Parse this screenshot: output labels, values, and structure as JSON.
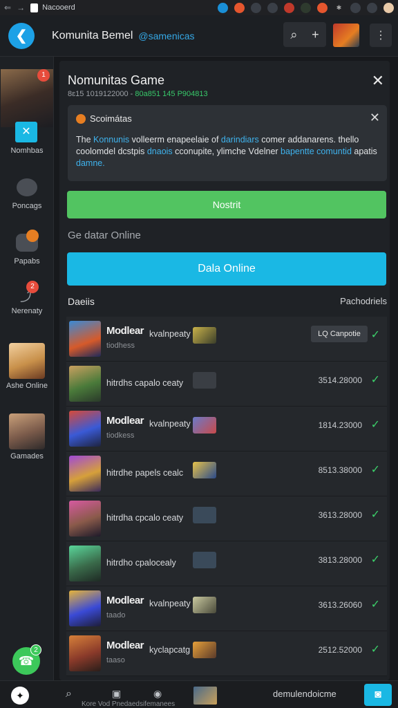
{
  "browser": {
    "tab_title": "Nacooerd",
    "back": "⇐",
    "forward": "→"
  },
  "header": {
    "title": "Komunita Bemel",
    "handle": "@samenicas",
    "search_icon": "⌕",
    "add_icon": "+",
    "menu_icon": "⋮"
  },
  "sidebar": {
    "items": [
      {
        "label": "Nomhbas"
      },
      {
        "label": "Poncags"
      },
      {
        "label": "Papabs"
      },
      {
        "label": "Nerenaty"
      },
      {
        "label": "Ashe Online"
      },
      {
        "label": "Gamades"
      }
    ],
    "badges": [
      "1",
      "2"
    ],
    "fab_badge": "2"
  },
  "panel": {
    "title": "Nomunitas Game",
    "sub_a": "8ɛ15 1019122000 -",
    "sub_b": "80a851 145 P904813",
    "notice_title": "Scoimátas",
    "notice_body_1": "The",
    "notice_body_2": "Konnunis",
    "notice_body_3": "volleerm enapeelaie of",
    "notice_body_4": "darindiars",
    "notice_body_5": "comer addanarens. thello coolomdel dcstpis",
    "notice_body_6": "dnaois",
    "notice_body_7": "cconupite, ylimche Vdelner",
    "notice_body_8": "bapentte comuntid",
    "notice_body_9": "apatis",
    "notice_body_10": "damne.",
    "green_button": "Nostrit",
    "section_label": "Ge datar Online",
    "blue_button": "Dala Online",
    "list_header_left": "Daeiis",
    "list_header_right": "Pachodriels"
  },
  "rows": [
    {
      "title": "Modlear",
      "title2": "kvalnpeaty",
      "sub": "tiodhess",
      "pill": "LQ Canpotie",
      "val": ""
    },
    {
      "title": "",
      "desc": "hitrdhs capalo ceaty",
      "val": "3514.28000"
    },
    {
      "title": "Modlear",
      "title2": "kvalnpeaty",
      "sub": "tiodkess",
      "val": "1814.23000"
    },
    {
      "title": "",
      "desc": "hitrdhe papels cealc",
      "val": "8513.38000"
    },
    {
      "title": "",
      "desc": "hitrdha cpcalo ceaty",
      "val": "3613.28000"
    },
    {
      "title": "",
      "desc": "hitrdho cpalocealy",
      "val": "3813.28000"
    },
    {
      "title": "Modlear",
      "title2": "kvalnpeaty",
      "sub": "taado",
      "val": "3613.26060"
    },
    {
      "title": "Modlear",
      "title2": "kyclapcatg",
      "sub": "taaso",
      "val": "2512.52000"
    }
  ],
  "bottom": {
    "label": "Kore Vod  Pnedaedsifemanees",
    "right": "demulendoicme"
  },
  "colors": {
    "accent_blue": "#1ab8e4",
    "accent_green": "#52c461",
    "check_green": "#3ccf6a",
    "bg": "#17191c"
  }
}
